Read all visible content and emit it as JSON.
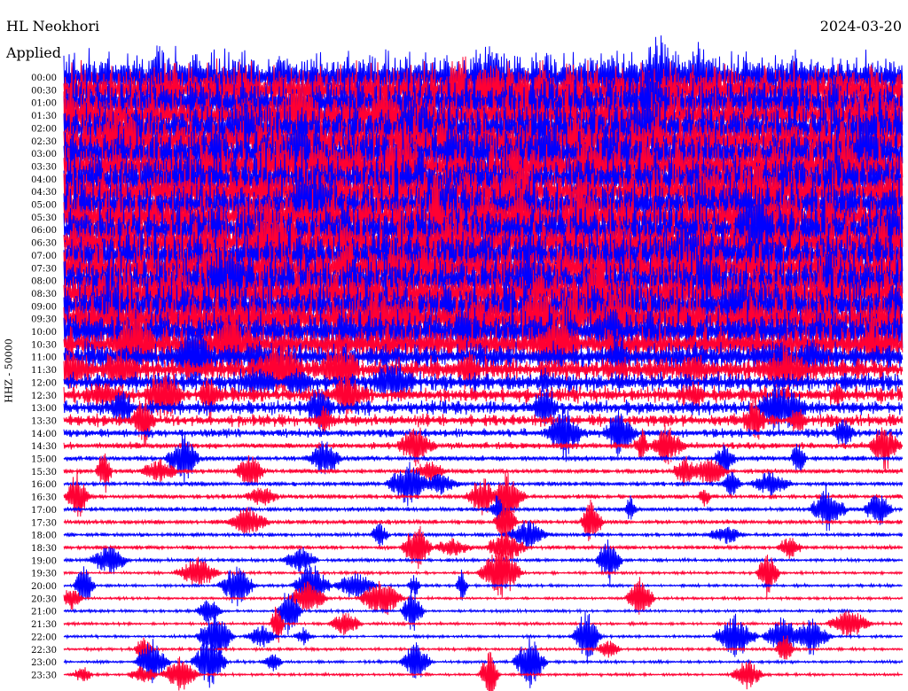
{
  "header": {
    "station": "HL Neokhori",
    "filter": "Applied",
    "date": "2024-03-20"
  },
  "chart_data": {
    "type": "line",
    "title": "HL Neokhori",
    "channel_label": "HHZ - 50000",
    "row_interval_minutes": 30,
    "time_labels": [
      "00:00",
      "00:30",
      "01:00",
      "01:30",
      "02:00",
      "02:30",
      "03:00",
      "03:30",
      "04:00",
      "04:30",
      "05:00",
      "05:30",
      "06:00",
      "06:30",
      "07:00",
      "07:30",
      "08:00",
      "08:30",
      "09:00",
      "09:30",
      "10:00",
      "10:30",
      "11:00",
      "11:30",
      "12:00",
      "12:30",
      "13:00",
      "13:30",
      "14:00",
      "14:30",
      "15:00",
      "15:30",
      "16:00",
      "16:30",
      "17:00",
      "17:30",
      "18:00",
      "18:30",
      "19:00",
      "19:30",
      "20:00",
      "20:30",
      "21:00",
      "21:30",
      "22:00",
      "22:30",
      "23:00",
      "23:30"
    ],
    "trace_colors": [
      "#0000ff",
      "#ff0033"
    ],
    "relative_amplitude": [
      0.95,
      0.95,
      0.95,
      0.95,
      0.95,
      0.95,
      0.95,
      0.95,
      0.95,
      0.95,
      0.95,
      0.95,
      0.95,
      0.95,
      0.95,
      0.95,
      0.95,
      0.95,
      0.95,
      0.95,
      0.8,
      0.65,
      0.5,
      0.42,
      0.35,
      0.3,
      0.27,
      0.22,
      0.16,
      0.12,
      0.1,
      0.09,
      0.08,
      0.08,
      0.08,
      0.08,
      0.07,
      0.07,
      0.06,
      0.05,
      0.05,
      0.05,
      0.05,
      0.05,
      0.05,
      0.05,
      0.05,
      0.05
    ]
  }
}
